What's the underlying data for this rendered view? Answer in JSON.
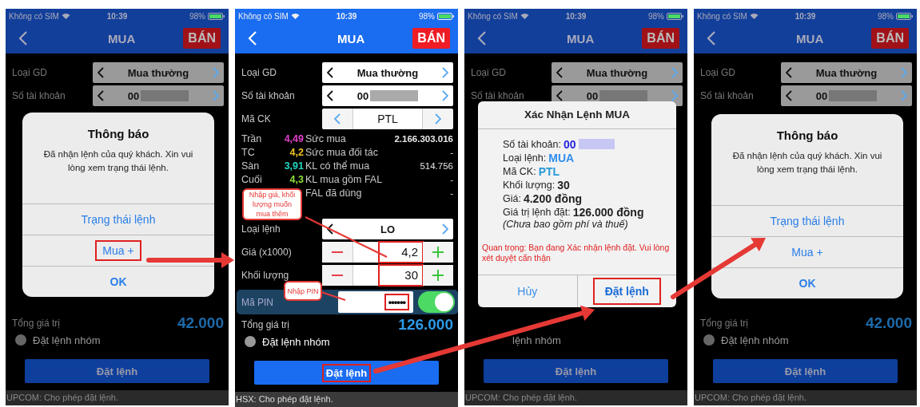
{
  "screens": [
    {
      "dimmed": true,
      "status": {
        "carrier": "Không có SIM",
        "time": "10:39",
        "battery": "98%"
      },
      "nav": {
        "title": "MUA",
        "sell": "BÁN"
      },
      "order_type": {
        "label": "Loại GD",
        "value": "Mua thường"
      },
      "account": {
        "label": "Số tài khoản",
        "value": "00"
      },
      "total": {
        "label": "Tổng giá trị",
        "value": "42.000"
      },
      "group_order": {
        "label": "Đặt lệnh nhóm",
        "checked": false
      },
      "submit": {
        "label": "Đặt lệnh",
        "highlighted": false
      },
      "footer": "UPCOM: Cho phép đặt lệnh.",
      "dialog": {
        "kind": "alert",
        "title": "Thông báo",
        "message": "Đã nhận lệnh của quý khách. Xin vui lòng xem trạng thái lệnh.",
        "actions": [
          {
            "label": "Trạng thái lệnh",
            "preferred": false,
            "highlighted": false
          },
          {
            "label": "Mua +",
            "preferred": false,
            "highlighted": true
          },
          {
            "label": "OK",
            "preferred": true,
            "highlighted": false
          }
        ]
      }
    },
    {
      "dimmed": false,
      "status": {
        "carrier": "Không có SIM",
        "time": "10:39",
        "battery": "98%"
      },
      "nav": {
        "title": "MUA",
        "sell": "BÁN"
      },
      "order_type": {
        "label": "Loại GD",
        "value": "Mua thường"
      },
      "account": {
        "label": "Số tài khoản",
        "value": "00"
      },
      "symbol": {
        "label": "Mã CK",
        "value": "PTL"
      },
      "stats": [
        {
          "label": "Trần",
          "value": "4,49",
          "color": "#e040c8",
          "metric": "Sức mua",
          "metric_value": "2.166.303.016"
        },
        {
          "label": "TC",
          "value": "4,2",
          "color": "#f2c522",
          "metric": "Sức mua đối tác",
          "metric_value": "-"
        },
        {
          "label": "Sàn",
          "value": "3,91",
          "color": "#22d6c0",
          "metric": "KL có thể mua",
          "metric_value": "514.756"
        },
        {
          "label": "Cuối",
          "value": "4,3",
          "color": "#8ee03a",
          "metric": "KL mua gồm FAL",
          "metric_value": "-"
        },
        {
          "metric": "FAL đã dùng",
          "metric_value": "-"
        }
      ],
      "order_kind": {
        "label": "Loại lệnh",
        "value": "LO"
      },
      "price": {
        "label": "Giá (x1000)",
        "value": "4,2",
        "highlighted": true
      },
      "quantity": {
        "label": "Khối lượng",
        "value": "30",
        "highlighted": true
      },
      "pin": {
        "label": "Mã PIN",
        "mask": "••••••",
        "highlighted": true,
        "on": true
      },
      "total": {
        "label": "Tổng giá trị",
        "value": "126.000"
      },
      "group_order": {
        "label": "Đặt lệnh nhóm",
        "checked": false
      },
      "submit": {
        "label": "Đặt lệnh",
        "highlighted": true
      },
      "footer": "HSX: Cho phép đặt lệnh."
    },
    {
      "dimmed": true,
      "status": {
        "carrier": "Không có SIM",
        "time": "10:39",
        "battery": "98%"
      },
      "nav": {
        "title": "MUA",
        "sell": "BÁN"
      },
      "order_type": {
        "label": "Loại GD",
        "value": "Mua thường"
      },
      "account": {
        "label": "Số tài khoản",
        "value": "00"
      },
      "group_order": {
        "label": "lệnh nhóm"
      },
      "submit": {
        "label": "Đặt lệnh",
        "highlighted": false
      },
      "footer": "UPCOM: Cho phép đặt lệnh.",
      "dialog": {
        "kind": "confirm",
        "title": "Xác Nhận Lệnh MUA",
        "details": [
          {
            "label": "Số tài khoản:",
            "value": "00",
            "color": "#2424e0",
            "masked": true
          },
          {
            "label": "Loại lệnh:",
            "value": "MUA",
            "color": "#2f8ef0",
            "masked": false
          },
          {
            "label": "Mã CK:",
            "value": "PTL",
            "color": "#2a9ad8",
            "masked": false
          },
          {
            "label": "Khối lượng:",
            "value": "30",
            "color": "#222222",
            "masked": false
          },
          {
            "label": "Giá:",
            "value": "4.200 đồng",
            "color": "#222222",
            "masked": false
          },
          {
            "label": "Giá trị lệnh đặt:",
            "value": "126.000 đồng",
            "color": "#222222",
            "masked": false
          }
        ],
        "note": "(Chưa bao gồm phí và thuế)",
        "warning": "Quan trọng: Bạn đang Xác nhận lệnh đặt. Vui lòng xét duyệt cẩn thận",
        "actions": [
          {
            "label": "Hủy",
            "preferred": false,
            "highlighted": false
          },
          {
            "label": "Đặt lệnh",
            "preferred": true,
            "highlighted": true
          }
        ]
      }
    },
    {
      "dimmed": true,
      "status": {
        "carrier": "Không có SIM",
        "time": "10:39",
        "battery": "98%"
      },
      "nav": {
        "title": "MUA",
        "sell": "BÁN"
      },
      "order_type": {
        "label": "Loại GD",
        "value": "Mua thường"
      },
      "account": {
        "label": "Số tài khoản",
        "value": "00"
      },
      "total": {
        "label": "Tổng giá trị",
        "value": "42.000"
      },
      "group_order": {
        "label": "Đặt lệnh nhóm",
        "checked": false
      },
      "submit": {
        "label": "Đặt lệnh",
        "highlighted": false
      },
      "footer": "UPCOM: Cho phép đặt lệnh.",
      "dialog": {
        "kind": "alert",
        "title": "Thông báo",
        "message": "Đã nhận lệnh của quý khách. Xin vui lòng xem trạng thái lệnh.",
        "actions": [
          {
            "label": "Trạng thái lệnh",
            "preferred": false,
            "highlighted": false
          },
          {
            "label": "Mua +",
            "preferred": false,
            "highlighted": false
          },
          {
            "label": "OK",
            "preferred": true,
            "highlighted": false
          }
        ]
      }
    }
  ],
  "callouts": [
    {
      "text": "Nhập giá, khối lượng muốn mua thêm"
    },
    {
      "text": "Nhập PIN"
    }
  ]
}
